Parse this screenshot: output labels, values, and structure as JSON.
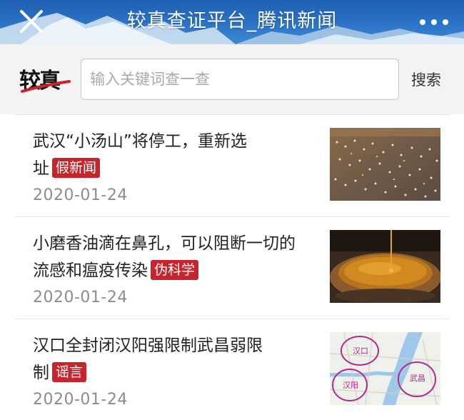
{
  "header": {
    "title": "较真查证平台_腾讯新闻",
    "close_icon": "close-icon",
    "more_icon": "more-dots-icon",
    "colors": {
      "bar_top": "#1f5fb3",
      "bar_bottom": "#3f89d3"
    }
  },
  "search": {
    "logo_text": "较真",
    "placeholder": "输入关键词查一查",
    "value": "",
    "button_label": "搜索"
  },
  "news": [
    {
      "title_part1": "武汉“小汤山”将停工，重新选",
      "title_part2": "址",
      "tag": "假新闻",
      "date": "2020-01-24",
      "thumb": "construction-site-image"
    },
    {
      "title_part1": "小磨香油滴在鼻孔，可以阻断一切的",
      "title_part2": "流感和瘟疫传染",
      "tag": "伪科学",
      "date": "2020-01-24",
      "thumb": "sesame-oil-bowl-image"
    },
    {
      "title_part1": "汉口全封闭汉阳强限制武昌弱限",
      "title_part2": "制",
      "tag": "谣言",
      "date": "2020-01-24",
      "thumb": "wuhan-map-image",
      "map_labels": [
        "汉口",
        "汉阳",
        "武昌"
      ]
    }
  ],
  "colors": {
    "tag_red": "#c8242b",
    "date_gray": "#8c8c8c"
  }
}
